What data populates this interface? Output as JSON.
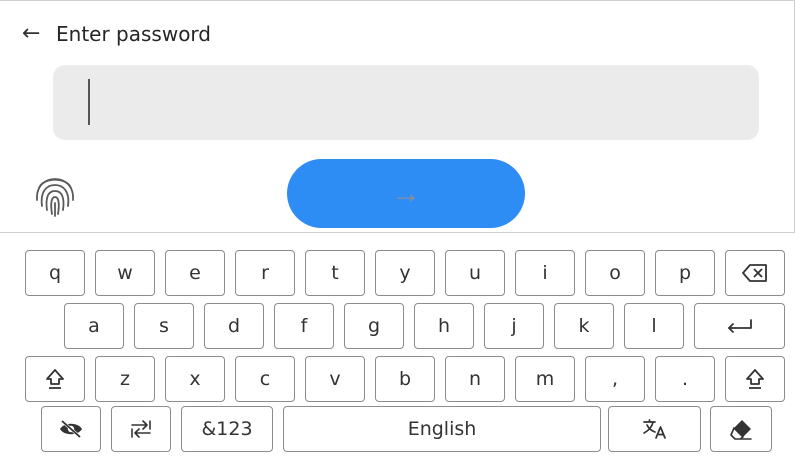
{
  "header": {
    "back_icon": "arrow-left-icon",
    "title": "Enter password"
  },
  "password": {
    "value": "",
    "placeholder": ""
  },
  "fingerprint_icon": "fingerprint-icon",
  "submit": {
    "icon": "arrow-right-icon",
    "glyph": "→"
  },
  "keyboard": {
    "row1": [
      "q",
      "w",
      "e",
      "r",
      "t",
      "y",
      "u",
      "i",
      "o",
      "p"
    ],
    "backspace_icon": "backspace-icon",
    "row2": [
      "a",
      "s",
      "d",
      "f",
      "g",
      "h",
      "j",
      "k",
      "l"
    ],
    "enter_icon": "enter-icon",
    "shift_icon": "shift-icon",
    "row3": [
      "z",
      "x",
      "c",
      "v",
      "b",
      "n",
      "m",
      ",",
      "."
    ],
    "row4": {
      "hide_icon": "eye-off-icon",
      "switch_icon": "keyboard-switch-icon",
      "symbols_label": "&123",
      "space_label": "English",
      "translate_icon": "translate-icon",
      "erase_icon": "eraser-icon"
    }
  }
}
